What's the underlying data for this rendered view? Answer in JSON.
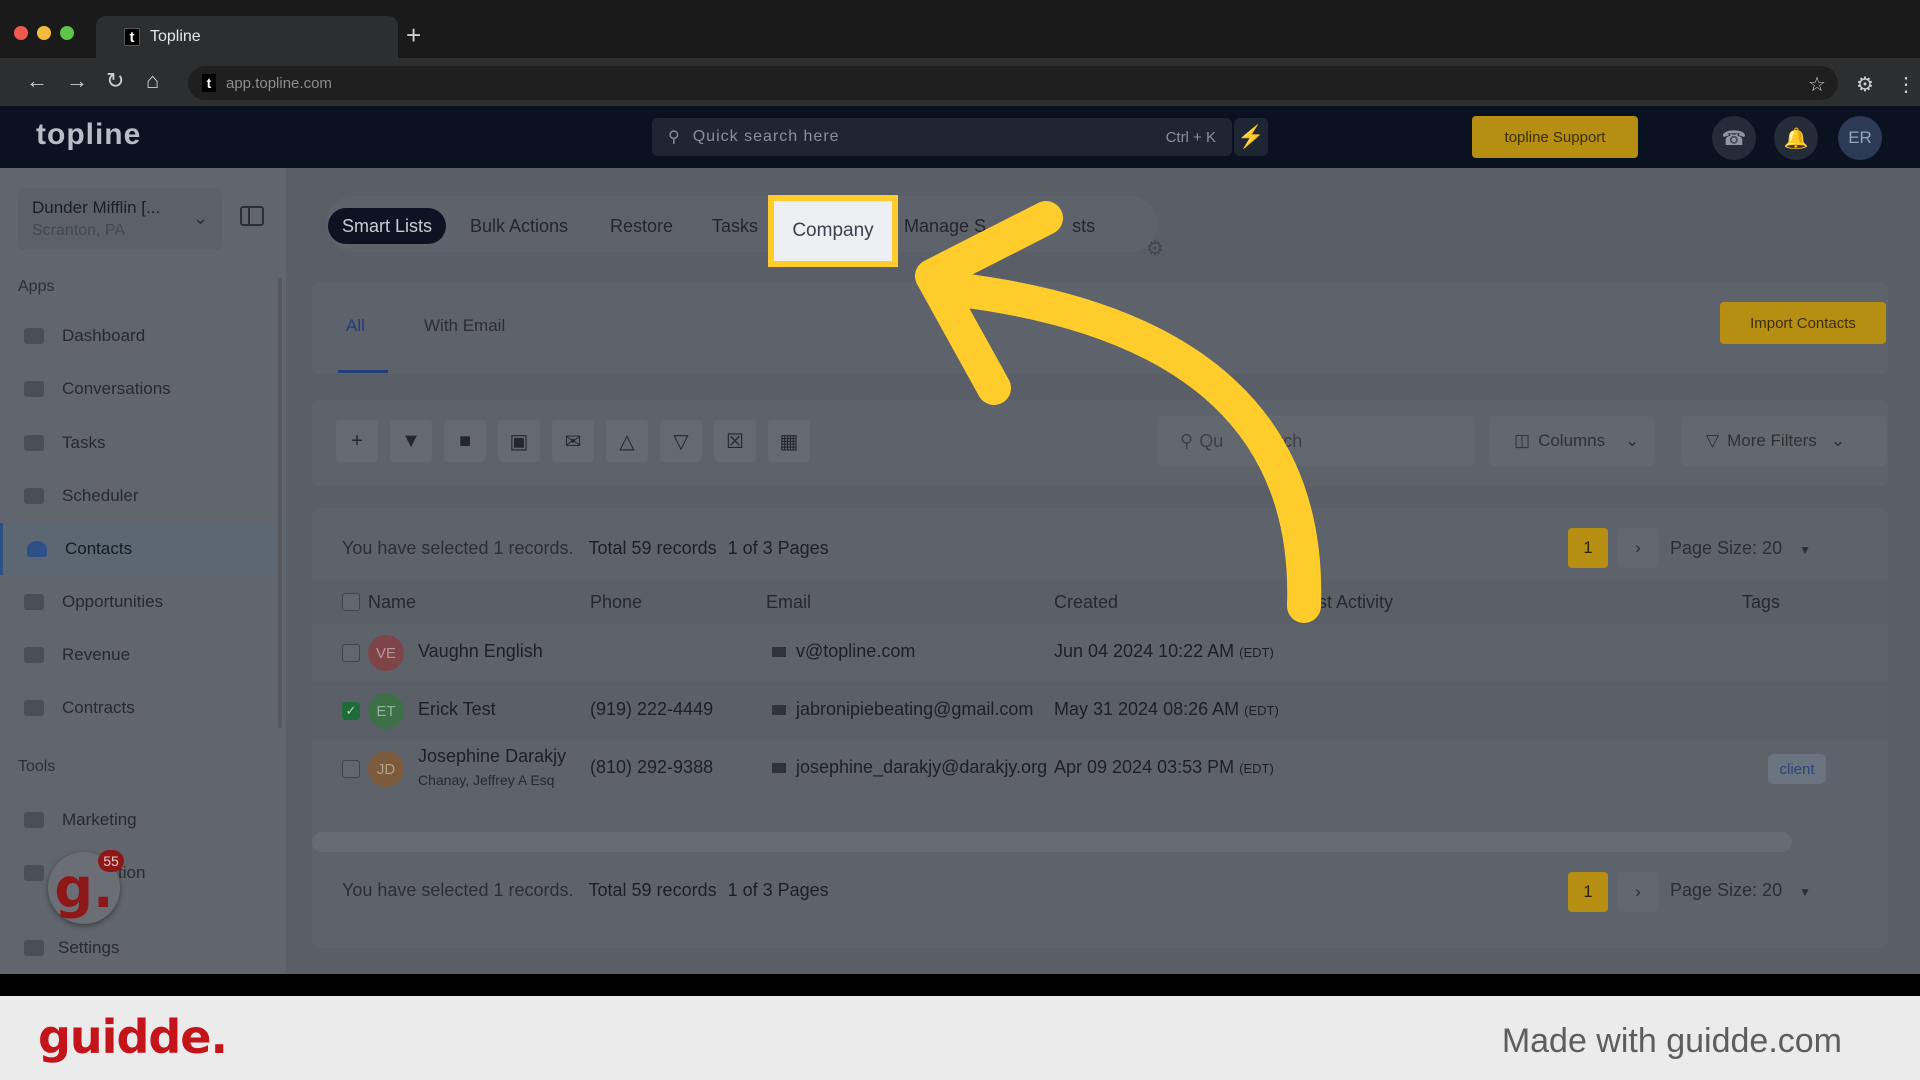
{
  "browser": {
    "tab_title": "Topline",
    "new_tab_symbol": "+",
    "url": "app.topline.com"
  },
  "header": {
    "logo": "topline",
    "search_placeholder": "Quick search here",
    "search_shortcut": "Ctrl + K",
    "support_label": "topline Support",
    "avatar_initials": "ER"
  },
  "sidebar": {
    "account_name": "Dunder Mifflin [...",
    "account_location": "Scranton, PA",
    "apps_heading": "Apps",
    "items": [
      {
        "label": "Dashboard"
      },
      {
        "label": "Conversations"
      },
      {
        "label": "Tasks"
      },
      {
        "label": "Scheduler"
      },
      {
        "label": "Contacts"
      },
      {
        "label": "Opportunities"
      },
      {
        "label": "Revenue"
      },
      {
        "label": "Contracts"
      }
    ],
    "tools_heading": "Tools",
    "tools_items": [
      {
        "label": "Marketing"
      },
      {
        "label": "tion"
      },
      {
        "label": "Settings"
      }
    ],
    "badge_letter": "g.",
    "badge_count": "55"
  },
  "top_tabs": {
    "smart_lists": "Smart Lists",
    "bulk_actions": "Bulk Actions",
    "restore": "Restore",
    "tasks": "Tasks",
    "company": "Company",
    "manage_prefix": "Manage S",
    "manage_suffix": "sts"
  },
  "sub_tabs": {
    "all": "All",
    "with_email": "With Email",
    "import_label": "Import Contacts"
  },
  "toolbar": {
    "search_prefix": "Qu",
    "search_suffix": "earch",
    "columns_label": "Columns",
    "more_filters_label": "More Filters"
  },
  "summary": {
    "selected_text": "You have selected 1 records.",
    "total_text": "Total 59 records",
    "pages_text": "1 of 3 Pages",
    "current_page": "1",
    "page_size": "Page Size: 20"
  },
  "table": {
    "headers": {
      "name": "Name",
      "phone": "Phone",
      "email": "Email",
      "created": "Created",
      "last_activity": "Last Activity",
      "tags": "Tags"
    },
    "rows": [
      {
        "initials": "VE",
        "name": "Vaughn English",
        "company": "",
        "phone": "",
        "email": "v@topline.com",
        "created": "Jun 04 2024 10:22 AM",
        "tz": "(EDT)",
        "tag": "",
        "checked": false
      },
      {
        "initials": "ET",
        "name": "Erick Test",
        "company": "",
        "phone": "(919) 222-4449",
        "email": "jabronipiebeating@gmail.com",
        "created": "May 31 2024 08:26 AM",
        "tz": "(EDT)",
        "tag": "",
        "checked": true
      },
      {
        "initials": "JD",
        "name": "Josephine Darakjy",
        "company": "Chanay, Jeffrey A Esq",
        "phone": "(810) 292-9388",
        "email": "josephine_darakjy@darakjy.org",
        "created": "Apr 09 2024 03:53 PM",
        "tz": "(EDT)",
        "tag": "client",
        "checked": false
      }
    ]
  },
  "footer": {
    "brand": "guidde.",
    "made_with": "Made with guidde.com"
  },
  "colors": {
    "highlight": "#ffcd2b",
    "accent_gold": "#b68e12",
    "brand_red": "#c3141a"
  }
}
